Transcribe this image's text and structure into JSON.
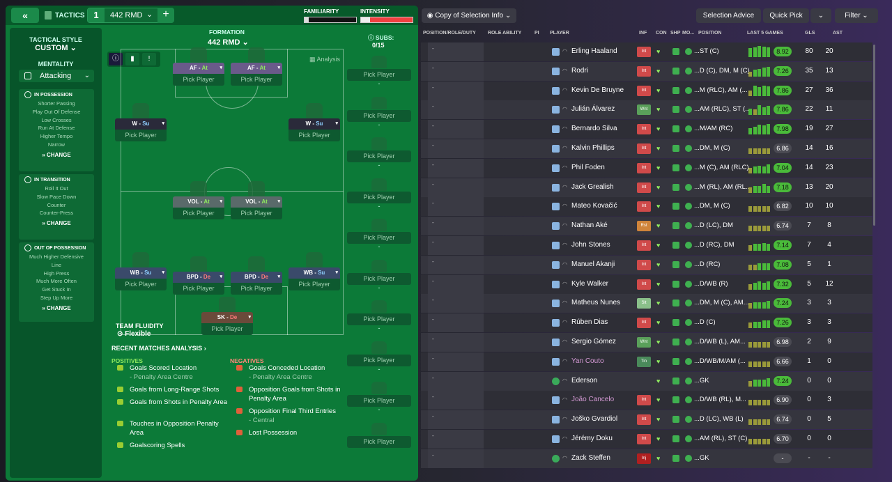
{
  "topbar": {
    "back_icon": "«",
    "tactics_label": "TACTICS",
    "slot_number": "1",
    "slot_name": "442 RMD",
    "add_icon": "+",
    "familiarity_label": "FAMILIARITY",
    "intensity_label": "INTENSITY",
    "familiarity_level": 0.08,
    "intensity_level": 0.18
  },
  "sidebar": {
    "style_label": "TACTICAL STYLE",
    "style_value": "CUSTOM",
    "mentality_label": "MENTALITY",
    "mentality_value": "Attacking",
    "in_possession": {
      "title": "IN POSSESSION",
      "items": [
        "Shorter Passing",
        "Play Out Of Defense",
        "Low Crosses",
        "Run At Defense",
        "Higher Tempo",
        "Narrow"
      ],
      "change": "CHANGE"
    },
    "in_transition": {
      "title": "IN TRANSITION",
      "items": [
        "Roll It Out",
        "Slow Pace Down",
        "Counter",
        "Counter-Press"
      ],
      "change": "CHANGE"
    },
    "out_of_possession": {
      "title": "OUT OF POSSESSION",
      "items": [
        "Much Higher Defensive",
        "Line",
        "High Press",
        "Much More Often",
        "Get Stuck In",
        "Step Up More"
      ],
      "change": "CHANGE"
    }
  },
  "pitch": {
    "formation_label": "FORMATION",
    "formation_value": "442 RMD",
    "subs_label": "SUBS:",
    "subs_value": "0/15",
    "analysis_label": "Analysis",
    "pick_label": "Pick Player",
    "sub_dash": "-",
    "slots": [
      {
        "role": "AF",
        "duty": "At",
        "style": "purple",
        "duty_class": "duty-at"
      },
      {
        "role": "AF",
        "duty": "At",
        "style": "purple",
        "duty_class": "duty-at"
      },
      {
        "role": "W",
        "duty": "Su",
        "style": "dark",
        "duty_class": "duty-su"
      },
      {
        "role": "W",
        "duty": "Su",
        "style": "dark",
        "duty_class": "duty-su"
      },
      {
        "role": "VOL",
        "duty": "At",
        "style": "grey",
        "duty_class": "duty-at"
      },
      {
        "role": "VOL",
        "duty": "At",
        "style": "grey",
        "duty_class": "duty-at"
      },
      {
        "role": "WB",
        "duty": "Su",
        "style": "blue",
        "duty_class": "duty-su"
      },
      {
        "role": "BPD",
        "duty": "De",
        "style": "blue",
        "duty_class": "duty-de"
      },
      {
        "role": "BPD",
        "duty": "De",
        "style": "blue",
        "duty_class": "duty-de"
      },
      {
        "role": "WB",
        "duty": "Su",
        "style": "blue",
        "duty_class": "duty-su"
      },
      {
        "role": "SK",
        "duty": "De",
        "style": "brown",
        "duty_class": "duty-de"
      }
    ],
    "fluidity_label": "TEAM FLUIDITY",
    "fluidity_value": "Flexible"
  },
  "analysis": {
    "title": "RECENT MATCHES ANALYSIS",
    "positives_label": "POSITIVES",
    "negatives_label": "NEGATIVES",
    "positives": [
      {
        "text": "Goals Scored Location",
        "sub": "- Penalty Area Centre"
      },
      {
        "text": "Goals from Long-Range Shots",
        "sub": ""
      },
      {
        "text": "Goals from Shots in Penalty Area",
        "sub": ""
      },
      {
        "text": "Touches in Opposition Penalty Area",
        "sub": ""
      },
      {
        "text": "Goalscoring Spells",
        "sub": ""
      }
    ],
    "negatives": [
      {
        "text": "Goals Conceded Location",
        "sub": "- Penalty Area Centre"
      },
      {
        "text": "Opposition Goals from Shots in Penalty Area",
        "sub": ""
      },
      {
        "text": "Opposition Final Third Entries",
        "sub": "- Central"
      },
      {
        "text": "Lost Possession",
        "sub": ""
      }
    ]
  },
  "right": {
    "copy_btn": "Copy of Selection Info",
    "selection_advice": "Selection Advice",
    "quick_pick": "Quick Pick",
    "filter": "Filter",
    "headers": [
      "POSITION/ROLE/DUTY",
      "ROLE ABILITY",
      "PI",
      "PLAYER",
      "INF",
      "CON",
      "SHP",
      "MO...",
      "POSITION",
      "LAST 5 GAMES",
      "GLS",
      "AST"
    ],
    "players": [
      {
        "name": "Erling Haaland",
        "inf": "Int",
        "inf_color": "#d04a4a",
        "pos": "...ST (C)",
        "rating": "8.92",
        "bars": [
          0.8,
          0.9,
          1,
          0.95,
          0.9
        ],
        "gls": "80",
        "ast": "20",
        "loan": false,
        "gk": false
      },
      {
        "name": "Rodri",
        "inf": "Int",
        "inf_color": "#d04a4a",
        "pos": "...D (C), DM, M (C)",
        "rating": "7.26",
        "bars": [
          0.4,
          0.6,
          0.7,
          0.8,
          0.85
        ],
        "gls": "35",
        "ast": "13",
        "loan": false,
        "gk": false
      },
      {
        "name": "Kevin De Bruyne",
        "inf": "Int",
        "inf_color": "#d04a4a",
        "pos": "...M (RLC), AM (...",
        "rating": "7.86",
        "bars": [
          0.5,
          0.9,
          0.8,
          0.9,
          0.85
        ],
        "gls": "27",
        "ast": "36",
        "loan": false,
        "gk": false
      },
      {
        "name": "Julián Álvarez",
        "inf": "Wnt",
        "inf_color": "#5aa05a",
        "pos": "...AM (RLC), ST (...",
        "rating": "7.86",
        "bars": [
          0.6,
          0.5,
          0.9,
          0.7,
          0.85
        ],
        "gls": "22",
        "ast": "11",
        "loan": false,
        "gk": false
      },
      {
        "name": "Bernardo Silva",
        "inf": "Int",
        "inf_color": "#d04a4a",
        "pos": "...M/AM (RC)",
        "rating": "7.98",
        "bars": [
          0.6,
          0.7,
          0.9,
          0.8,
          0.95
        ],
        "gls": "19",
        "ast": "27",
        "loan": false,
        "gk": false
      },
      {
        "name": "Kalvin Phillips",
        "inf": "Int",
        "inf_color": "#d04a4a",
        "pos": "...DM, M (C)",
        "rating": "6.86",
        "bars": [
          0.5,
          0.5,
          0.5,
          0.5,
          0.5
        ],
        "gls": "14",
        "ast": "16",
        "loan": false,
        "gk": false
      },
      {
        "name": "Phil Foden",
        "inf": "Int",
        "inf_color": "#d04a4a",
        "pos": "...M (C), AM (RLC)",
        "rating": "7.04",
        "bars": [
          0.5,
          0.6,
          0.7,
          0.6,
          0.8
        ],
        "gls": "14",
        "ast": "23",
        "loan": false,
        "gk": false
      },
      {
        "name": "Jack Grealish",
        "inf": "Int",
        "inf_color": "#d04a4a",
        "pos": "...M (RL), AM (RL...",
        "rating": "7.18",
        "bars": [
          0.5,
          0.6,
          0.6,
          0.8,
          0.6
        ],
        "gls": "13",
        "ast": "20",
        "loan": false,
        "gk": false
      },
      {
        "name": "Mateo Kovačić",
        "inf": "Int",
        "inf_color": "#d04a4a",
        "pos": "...DM, M (C)",
        "rating": "6.82",
        "bars": [
          0.5,
          0.5,
          0.5,
          0.5,
          0.5
        ],
        "gls": "10",
        "ast": "10",
        "loan": false,
        "gk": false
      },
      {
        "name": "Nathan Aké",
        "inf": "Rst",
        "inf_color": "#d0843a",
        "pos": "...D (LC), DM",
        "rating": "6.74",
        "bars": [
          0.5,
          0.5,
          0.5,
          0.5,
          0.5
        ],
        "gls": "7",
        "ast": "8",
        "loan": false,
        "gk": false
      },
      {
        "name": "John Stones",
        "inf": "Int",
        "inf_color": "#d04a4a",
        "pos": "...D (RC), DM",
        "rating": "7.14",
        "bars": [
          0.5,
          0.6,
          0.6,
          0.7,
          0.6
        ],
        "gls": "7",
        "ast": "4",
        "loan": false,
        "gk": false
      },
      {
        "name": "Manuel Akanji",
        "inf": "Int",
        "inf_color": "#d04a4a",
        "pos": "...D (RC)",
        "rating": "7.08",
        "bars": [
          0.5,
          0.5,
          0.6,
          0.6,
          0.6
        ],
        "gls": "5",
        "ast": "1",
        "loan": false,
        "gk": false
      },
      {
        "name": "Kyle Walker",
        "inf": "Int",
        "inf_color": "#d04a4a",
        "pos": "...D/WB (R)",
        "rating": "7.32",
        "bars": [
          0.5,
          0.6,
          0.7,
          0.6,
          0.7
        ],
        "gls": "5",
        "ast": "12",
        "loan": false,
        "gk": false
      },
      {
        "name": "Matheus Nunes",
        "inf": "Slt",
        "inf_color": "#8ac08a",
        "pos": "...DM, M (C), AM...",
        "rating": "7.24",
        "bars": [
          0.5,
          0.6,
          0.6,
          0.6,
          0.7
        ],
        "gls": "3",
        "ast": "3",
        "loan": false,
        "gk": false
      },
      {
        "name": "Rúben Dias",
        "inf": "Int",
        "inf_color": "#d04a4a",
        "pos": "...D (C)",
        "rating": "7.26",
        "bars": [
          0.5,
          0.6,
          0.6,
          0.7,
          0.7
        ],
        "gls": "3",
        "ast": "3",
        "loan": false,
        "gk": false
      },
      {
        "name": "Sergio Gómez",
        "inf": "Wnt",
        "inf_color": "#5aa05a",
        "pos": "...D/WB (L), AM...",
        "rating": "6.98",
        "bars": [
          0.5,
          0.5,
          0.5,
          0.5,
          0.5
        ],
        "gls": "2",
        "ast": "9",
        "loan": false,
        "gk": false
      },
      {
        "name": "Yan Couto",
        "inf": "Tin",
        "inf_color": "#4a8a5a",
        "pos": "...D/WB/M/AM (...",
        "rating": "6.66",
        "bars": [
          0.5,
          0.5,
          0.5,
          0.5,
          0.5
        ],
        "gls": "1",
        "ast": "0",
        "loan": true,
        "gk": false
      },
      {
        "name": "Ederson",
        "inf": "",
        "inf_color": "transparent",
        "pos": "...GK",
        "rating": "7.24",
        "bars": [
          0.5,
          0.6,
          0.6,
          0.6,
          0.7
        ],
        "gls": "0",
        "ast": "0",
        "loan": false,
        "gk": true
      },
      {
        "name": "João Cancelo",
        "inf": "Int",
        "inf_color": "#d04a4a",
        "pos": "...D/WB (RL), M...",
        "rating": "6.90",
        "bars": [
          0.5,
          0.5,
          0.5,
          0.5,
          0.5
        ],
        "gls": "0",
        "ast": "3",
        "loan": true,
        "gk": false
      },
      {
        "name": "Joško Gvardiol",
        "inf": "Int",
        "inf_color": "#d04a4a",
        "pos": "...D (LC), WB (L)",
        "rating": "6.74",
        "bars": [
          0.5,
          0.5,
          0.5,
          0.5,
          0.5
        ],
        "gls": "0",
        "ast": "5",
        "loan": false,
        "gk": false
      },
      {
        "name": "Jérémy Doku",
        "inf": "Int",
        "inf_color": "#d04a4a",
        "pos": "...AM (RL), ST (C)",
        "rating": "6.70",
        "bars": [
          0.5,
          0.5,
          0.5,
          0.5,
          0.5
        ],
        "gls": "0",
        "ast": "0",
        "loan": false,
        "gk": false
      },
      {
        "name": "Zack Steffen",
        "inf": "Inj",
        "inf_color": "#b02020",
        "pos": "...GK",
        "rating": "-",
        "bars": [
          0,
          0,
          0,
          0,
          0
        ],
        "gls": "-",
        "ast": "-",
        "loan": false,
        "gk": true
      }
    ]
  }
}
